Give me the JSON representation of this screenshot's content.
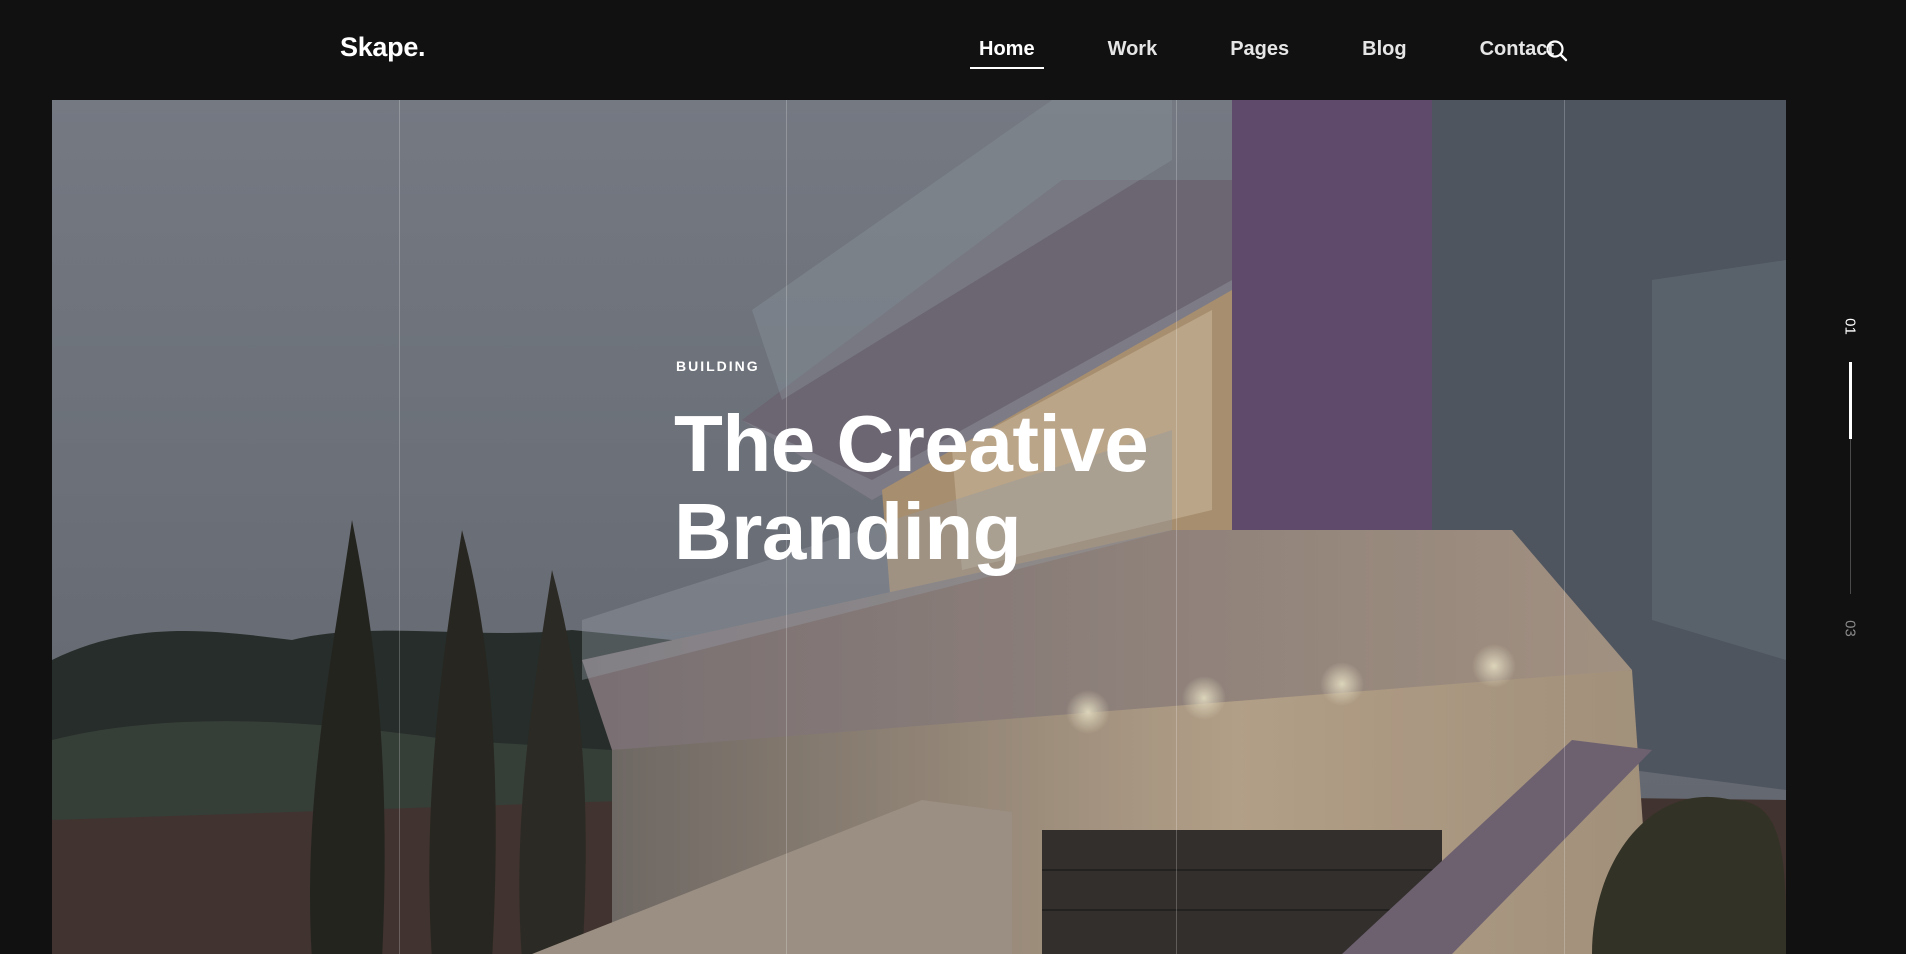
{
  "brand": {
    "logo": "Skape."
  },
  "nav": {
    "items": [
      {
        "label": "Home",
        "active": true
      },
      {
        "label": "Work"
      },
      {
        "label": "Pages"
      },
      {
        "label": "Blog"
      },
      {
        "label": "Contact"
      }
    ],
    "search_icon": "search-icon"
  },
  "hero": {
    "eyebrow": "BUILDING",
    "title_line1": "The Creative",
    "title_line2": "Branding"
  },
  "slider": {
    "current": "01",
    "total": "03",
    "progress": 0.33
  },
  "colors": {
    "background": "#111111",
    "text": "#ffffff",
    "accent_purple": "#6e557a"
  }
}
